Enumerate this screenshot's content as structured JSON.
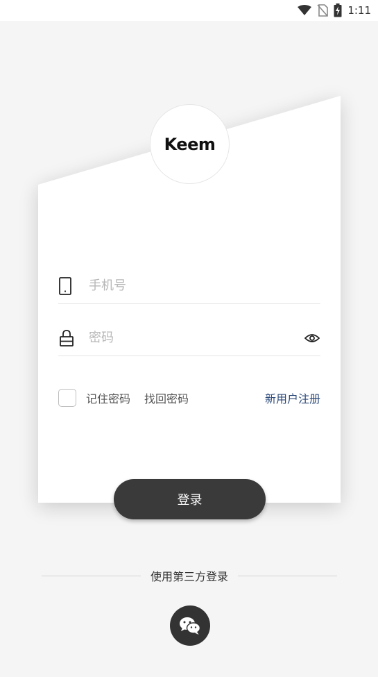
{
  "status_bar": {
    "time": "1:11",
    "icons": [
      "wifi-icon",
      "no-sim-icon",
      "battery-charging-icon"
    ]
  },
  "logo": {
    "text": "Keem"
  },
  "phone_field": {
    "icon": "phone-icon",
    "placeholder": "手机号",
    "value": ""
  },
  "password_field": {
    "icon": "lock-icon",
    "placeholder": "密码",
    "value": "",
    "toggle_icon": "eye-icon"
  },
  "options": {
    "remember_label": "记住密码",
    "remember_checked": false,
    "forgot_label": "找回密码",
    "register_label": "新用户注册"
  },
  "login_button": {
    "label": "登录"
  },
  "third_party": {
    "label": "使用第三方登录",
    "icon": "wechat-icon"
  },
  "colors": {
    "background": "#f5f5f5",
    "card": "#ffffff",
    "button": "#3a3a3a",
    "link": "#2c4a7a"
  }
}
